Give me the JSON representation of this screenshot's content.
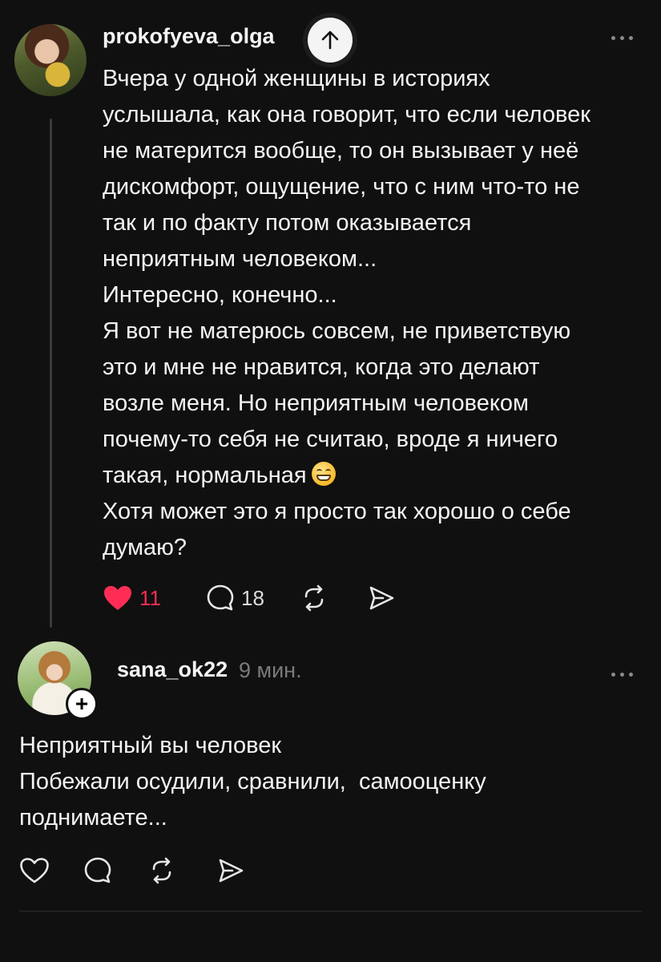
{
  "post1": {
    "username": "prokofyeva_olga",
    "lines": [
      "Вчера у одной женщины в историях",
      "услышала, как она говорит, что если человек",
      "не матерится вообще, то он вызывает у неё",
      "дискомфорт, ощущение, что с ним что-то не",
      "так и по факту потом оказывается",
      "неприятным человеком...",
      "Интересно, конечно...",
      "Я вот не матерюсь совсем, не приветствую",
      "это и мне не нравится, когда это делают",
      "возле меня. Но неприятным человеком",
      "почему-то себя не считаю, вроде я ничего",
      "такая, нормальная",
      "Хотя может это я просто так хорошо о себе",
      "думаю?"
    ],
    "emoji": "grinning-face-emoji",
    "likes": "11",
    "comments": "18",
    "liked": true,
    "like_color": "#ff2d55"
  },
  "post2": {
    "username": "sana_ok22",
    "timestamp": "9 мин.",
    "follow_label": "+",
    "lines": [
      "Неприятный вы человек",
      "Побежали осудили, сравнили,  самооценку",
      "поднимаете..."
    ]
  },
  "icons": {
    "scroll_top": "arrow-up-icon",
    "more": "more-dots-icon",
    "like": "heart-icon",
    "comment": "comment-bubble-icon",
    "repost": "repost-icon",
    "share": "send-icon"
  },
  "colors": {
    "background": "#101010",
    "text": "#f4f4f4",
    "muted": "#7a7a7a"
  }
}
